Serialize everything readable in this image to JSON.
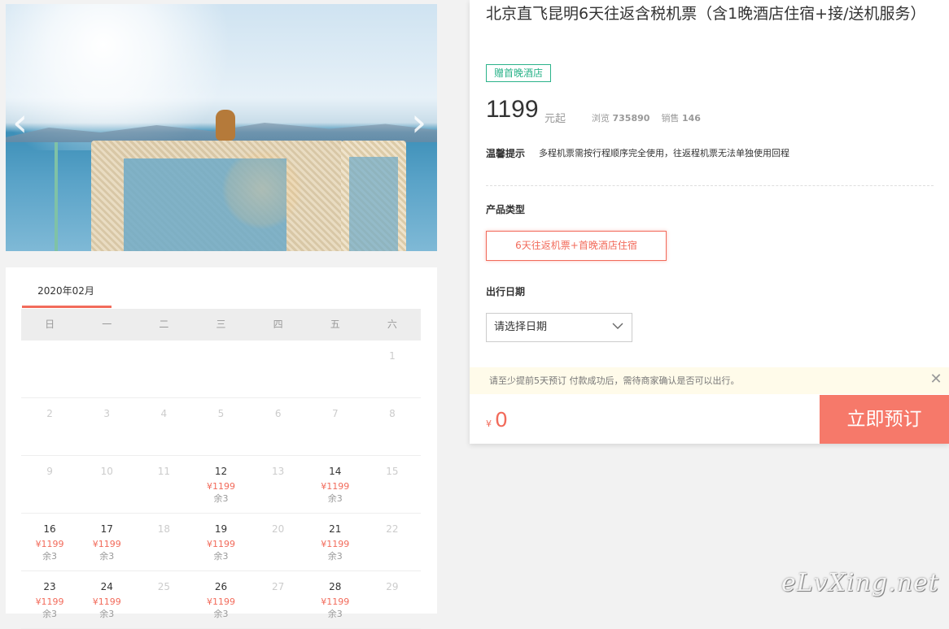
{
  "hero": {
    "prev_icon": "chevron-left-icon",
    "next_icon": "chevron-right-icon"
  },
  "calendar": {
    "month": "2020年02月",
    "weekdays": [
      "日",
      "一",
      "二",
      "三",
      "四",
      "五",
      "六"
    ],
    "weeks": [
      [
        {
          "d": ""
        },
        {
          "d": ""
        },
        {
          "d": ""
        },
        {
          "d": ""
        },
        {
          "d": ""
        },
        {
          "d": ""
        },
        {
          "d": "1"
        }
      ],
      [
        {
          "d": "2"
        },
        {
          "d": "3"
        },
        {
          "d": "4"
        },
        {
          "d": "5"
        },
        {
          "d": "6"
        },
        {
          "d": "7"
        },
        {
          "d": "8"
        }
      ],
      [
        {
          "d": "9"
        },
        {
          "d": "10"
        },
        {
          "d": "11"
        },
        {
          "d": "12",
          "p": "¥1199",
          "s": "余3"
        },
        {
          "d": "13"
        },
        {
          "d": "14",
          "p": "¥1199",
          "s": "余3"
        },
        {
          "d": "15"
        }
      ],
      [
        {
          "d": "16",
          "p": "¥1199",
          "s": "余3"
        },
        {
          "d": "17",
          "p": "¥1199",
          "s": "余3"
        },
        {
          "d": "18"
        },
        {
          "d": "19",
          "p": "¥1199",
          "s": "余3"
        },
        {
          "d": "20"
        },
        {
          "d": "21",
          "p": "¥1199",
          "s": "余3"
        },
        {
          "d": "22"
        }
      ],
      [
        {
          "d": "23",
          "p": "¥1199",
          "s": "余3"
        },
        {
          "d": "24",
          "p": "¥1199",
          "s": "余3"
        },
        {
          "d": "25"
        },
        {
          "d": "26",
          "p": "¥1199",
          "s": "余3"
        },
        {
          "d": "27"
        },
        {
          "d": "28",
          "p": "¥1199",
          "s": "余3"
        },
        {
          "d": "29"
        }
      ]
    ]
  },
  "product": {
    "title": "北京直飞昆明6天往返含税机票（含1晚酒店住宿+接/送机服务）",
    "tag": "赠首晚酒店",
    "price": "1199",
    "price_unit": "元起",
    "views_label": "浏览",
    "views": "735890",
    "sales_label": "销售",
    "sales": "146",
    "tip_label": "温馨提示",
    "tip_text": "多程机票需按行程顺序完全使用，往返程机票无法单独使用回程",
    "type_label": "产品类型",
    "type_option": "6天往返机票+首晚酒店住宿",
    "date_label": "出行日期",
    "date_placeholder": "请选择日期",
    "notice": "请至少提前5天预订 付款成功后，需待商家确认是否可以出行。",
    "currency": "¥",
    "total": "0",
    "book_label": "立即预订"
  },
  "watermark": "eLvXing.net",
  "colors": {
    "accent": "#f26b5b",
    "tag_green": "#2bb38a",
    "book_button": "#f6796a"
  }
}
